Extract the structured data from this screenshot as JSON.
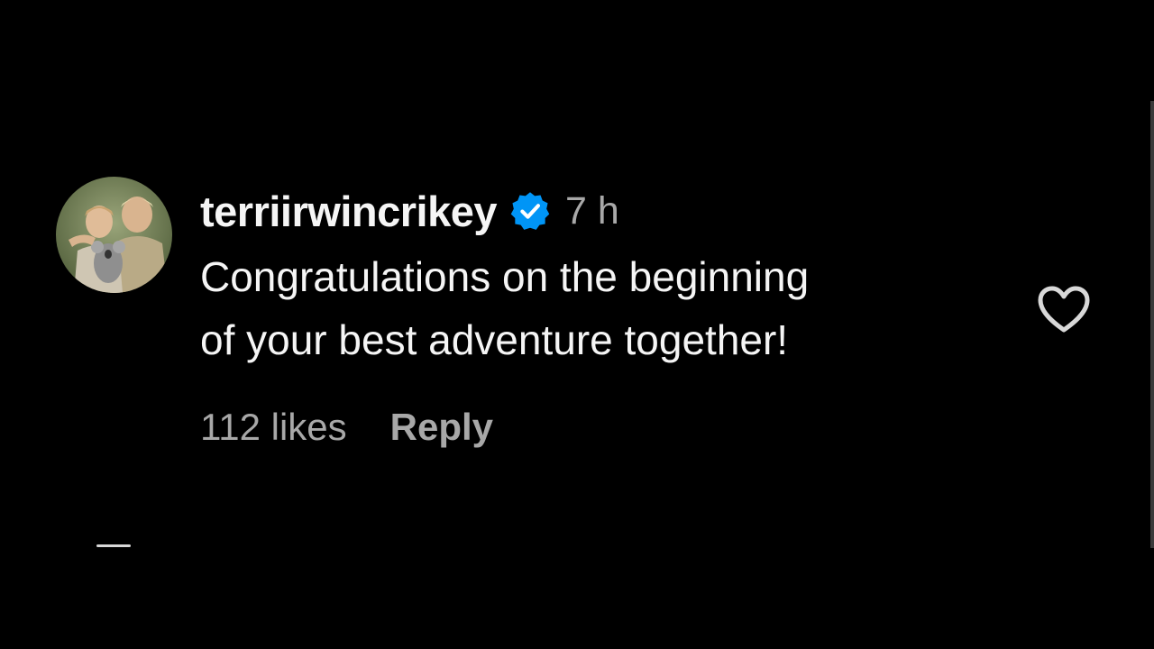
{
  "comment": {
    "username": "terriirwincrikey",
    "verified": true,
    "time": "7 h",
    "text_line1": "Congratulations on the beginning",
    "text_line2": "of your best adventure together!",
    "likes": "112 likes",
    "reply_label": "Reply",
    "avatar_icon": "profile-photo",
    "verified_icon": "verified-badge-icon",
    "like_icon": "heart-outline-icon"
  },
  "colors": {
    "background": "#000000",
    "text_primary": "#f5f5f5",
    "text_secondary": "#a8a8a8",
    "verified_blue": "#0095f6"
  }
}
